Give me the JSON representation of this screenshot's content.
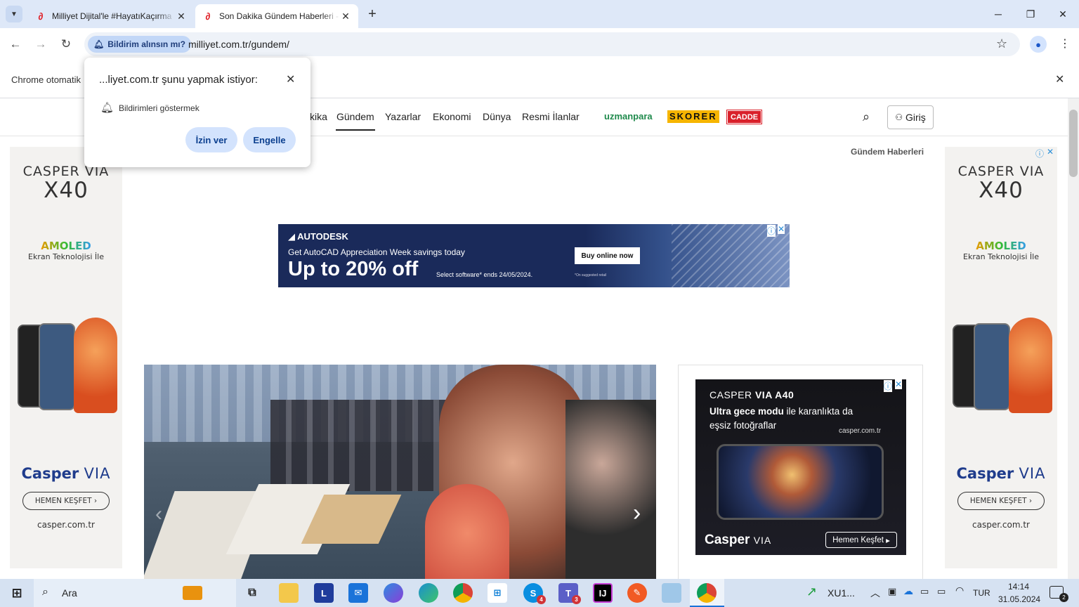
{
  "browser": {
    "tabs": [
      {
        "title": "Milliyet Dijital'le #HayatıKaçırma",
        "active": false
      },
      {
        "title": "Son Dakika Gündem Haberleri - S",
        "active": true
      }
    ],
    "new_tab": "+",
    "url": "milliyet.com.tr/gundem/",
    "permission_chip": "Bildirim alınsın mı?",
    "infobar_text": "Chrome otomatik"
  },
  "popup": {
    "title": "...liyet.com.tr şunu yapmak istiyor:",
    "permission": "Bildirimleri göstermek",
    "allow": "İzin ver",
    "block": "Engelle"
  },
  "site": {
    "nav": [
      "kika",
      "Gündem",
      "Yazarlar",
      "Ekonomi",
      "Dünya",
      "Resmi İlanlar"
    ],
    "partners": [
      "uzmanpara",
      "SKORER",
      "CADDE"
    ],
    "login": "Giriş",
    "section_label": "Gündem Haberleri"
  },
  "ads": {
    "side": {
      "brand_top": "CASPER VIA",
      "model": "X40",
      "tech": "AMOLED",
      "tech_sub": "Ekran Teknolojisi İle",
      "brand_name": "Casper",
      "brand_suffix": "VIA",
      "cta": "HEMEN KEŞFET",
      "site": "casper.com.tr"
    },
    "banner": {
      "company": "AUTODESK",
      "subtitle": "Get AutoCAD Appreciation Week savings today",
      "headline": "Up to 20% off",
      "note": "Select software* ends 24/05/2024.",
      "small": "*On suggested retail",
      "button": "Buy online now"
    },
    "box": {
      "title_brand": "CASPER",
      "title_model": "VIA A40",
      "line1_bold": "Ultra gece modu",
      "line1_rest": " ile karanlıkta da",
      "line2": "eşsiz fotoğraflar",
      "site": "casper.com.tr",
      "brand_name": "Casper",
      "brand_suffix": "VIA",
      "cta": "Hemen Keşfet"
    }
  },
  "taskbar": {
    "search": "Ara",
    "stock": "XU1...",
    "lang": "TUR",
    "time": "14:14",
    "date": "31.05.2024",
    "notif_count": "2",
    "skype_badge": "4",
    "teams_badge": "3"
  },
  "colors": {
    "brand_red": "#e01b22",
    "chrome_tab_bg": "#dee8f8",
    "autodesk_navy": "#1a2a5a",
    "taskbar": "#d6e2f2"
  }
}
